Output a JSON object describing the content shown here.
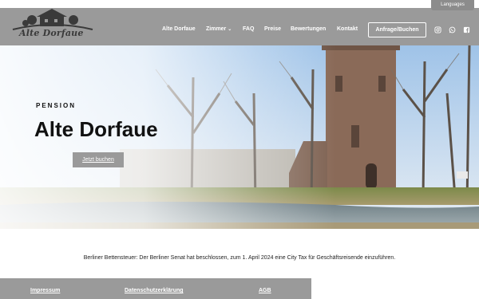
{
  "language_button": "Languages",
  "logo": {
    "text": "Alte Dorfaue"
  },
  "nav": {
    "items": [
      "Alte Dorfaue",
      "Zimmer",
      "FAQ",
      "Preise",
      "Bewertungen",
      "Kontakt"
    ],
    "zimmer_arrow": "⌄",
    "book_button": "Anfrage/Buchen"
  },
  "social": {
    "icons": [
      "instagram-icon",
      "whatsapp-icon",
      "facebook-icon"
    ]
  },
  "hero": {
    "eyebrow": "PENSION",
    "title": "Alte Dorfaue",
    "cta": "Jetzt buchen"
  },
  "notice": "Berliner Bettensteuer: Der Berliner Senat hat beschlossen, zum 1. April 2024 eine City Tax für Geschäftsreisende einzuführen.",
  "footer": {
    "links": [
      "Impressum",
      "Datenschutzerklärung",
      "AGB"
    ]
  },
  "colors": {
    "header_bg": "#9a9a9a",
    "accent": "#ffffff"
  }
}
